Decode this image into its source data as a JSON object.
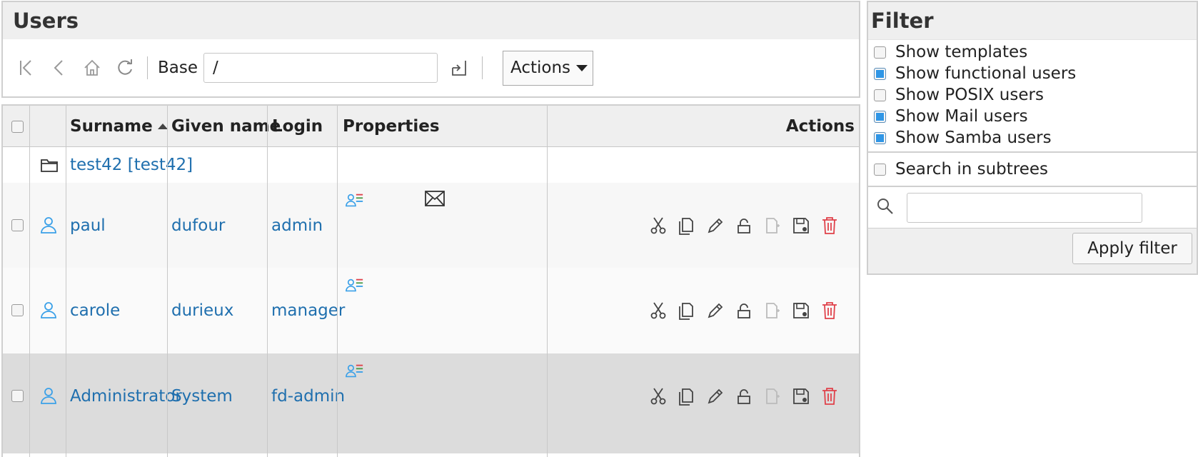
{
  "users_panel": {
    "title": "Users",
    "toolbar": {
      "icons": [
        "first-page-icon",
        "back-icon",
        "home-icon",
        "reload-icon",
        "submit-base-icon"
      ],
      "base_label": "Base",
      "base_value": "/",
      "actions_label": "Actions"
    }
  },
  "table": {
    "columns": {
      "surname": "Surname",
      "given_name": "Given name",
      "login": "Login",
      "properties": "Properties",
      "actions": "Actions"
    },
    "sort": {
      "column": "Surname",
      "direction": "ascending"
    },
    "department": {
      "label": "test42 [test42]"
    },
    "rows": [
      {
        "surname": "paul",
        "given_name": "dufour",
        "login": "admin",
        "has_mail": true
      },
      {
        "surname": "carole",
        "given_name": "durieux",
        "login": "manager",
        "has_mail": false
      },
      {
        "surname": "Administrator",
        "given_name": "System",
        "login": "fd-admin",
        "has_mail": false
      }
    ],
    "row_action_icons": [
      "cut-icon",
      "copy-icon",
      "edit-icon",
      "lock-icon",
      "template-icon",
      "snapshot-icon",
      "delete-icon"
    ]
  },
  "filter": {
    "title": "Filter",
    "options": [
      {
        "label": "Show templates",
        "checked": false
      },
      {
        "label": "Show functional users",
        "checked": true
      },
      {
        "label": "Show POSIX users",
        "checked": false
      },
      {
        "label": "Show Mail users",
        "checked": true
      },
      {
        "label": "Show Samba users",
        "checked": true
      }
    ],
    "subtree": {
      "label": "Search in subtrees",
      "checked": false
    },
    "search_value": "",
    "apply_label": "Apply filter"
  },
  "colors": {
    "link": "#1f6fae",
    "user_icon": "#3aa0e8",
    "delete_icon": "#e0414a",
    "selected_row": "#dcdcdc"
  }
}
